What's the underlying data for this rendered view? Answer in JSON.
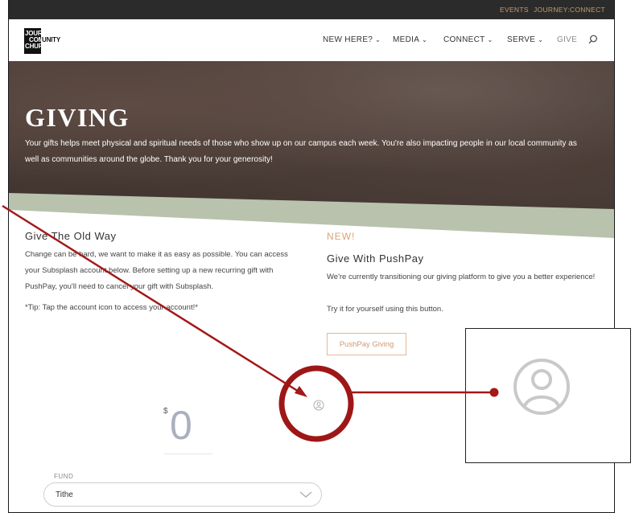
{
  "topbar": {
    "events": "EVENTS",
    "journey_connect": "JOURNEY:CONNECT"
  },
  "logo": {
    "line1": "JOURNEY",
    "line2a": "COMM",
    "line2b": "UNITY",
    "line3": "CHURCH"
  },
  "nav": {
    "items": [
      {
        "label": "NEW HERE?",
        "chevron": true
      },
      {
        "label": "MEDIA",
        "chevron": true
      },
      {
        "label": "CONNECT",
        "chevron": true
      },
      {
        "label": "SERVE",
        "chevron": true
      },
      {
        "label": "GIVE",
        "chevron": false
      }
    ],
    "search_icon": "search-icon"
  },
  "hero": {
    "title": "GIVING",
    "text": "Your gifts helps meet physical and spiritual needs of those who show up on our campus each week. You're also impacting people in our local community as well as communities around the globe. Thank you for your generosity!"
  },
  "old_way": {
    "title": "Give The Old Way",
    "text": "Change can be hard, we want to make it as easy as possible. You can access your Subsplash account below. Before setting up a new recurring gift with PushPay, you'll need to cancel your gift with Subsplash.",
    "tip": "*Tip: Tap the account icon to access your account!*"
  },
  "pushpay": {
    "new_label": "NEW!",
    "title": "Give With PushPay",
    "text1": "We're currently transitioning our giving platform to give you a better experience!",
    "text2": "Try it for yourself using this button.",
    "button": "PushPay Giving"
  },
  "giving_form": {
    "currency": "$",
    "amount": "0",
    "fund_label": "FUND",
    "fund_value": "Tithe",
    "account_icon": "account-icon"
  },
  "colors": {
    "accent": "#d9a27a",
    "annotation": "#a31818",
    "topbar": "#2b2b2b",
    "wedge": "#b8c2ad"
  }
}
